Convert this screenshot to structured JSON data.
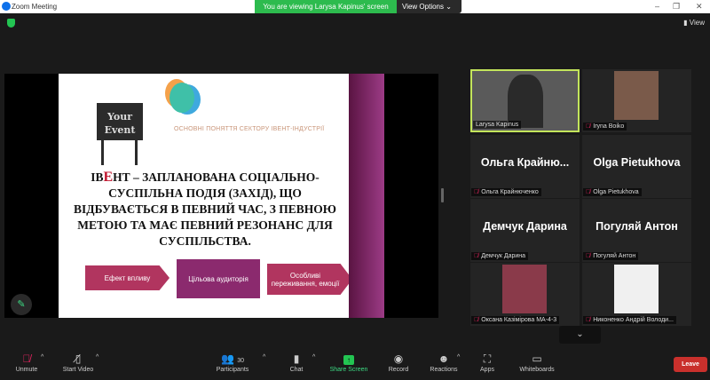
{
  "window": {
    "title": "Zoom Meeting",
    "minimize": "–",
    "maximize": "❐",
    "close": "✕"
  },
  "banner": {
    "text": "You are viewing Larysa Kapinus' screen",
    "view_options": "View Options ⌄"
  },
  "view_button": "View",
  "slide": {
    "board_text": "Your Event",
    "subtitle": "ОСНОВНІ ПОНЯТТЯ СЕКТОРУ ІВЕНТ-ІНДУСТРІЇ",
    "definition_prefix": "ІВ",
    "definition_red": "Е",
    "definition_rest": "НТ – ЗАПЛАНОВАНА СОЦІАЛЬНО-СУСПІЛЬНА ПОДІЯ (ЗАХІД), ЩО ВІДБУВАЄТЬСЯ В ПЕВНИЙ ЧАС, З ПЕВНОЮ МЕТОЮ ТА МАЄ ПЕВНИЙ РЕЗОНАНС ДЛЯ СУСПІЛЬСТВА.",
    "boxes": [
      "Ефект впливу",
      "Цільова аудиторія",
      "Особливі переживання, емоції"
    ]
  },
  "participants": [
    {
      "label": "Larysa Kapinus",
      "big": "",
      "active": true
    },
    {
      "label": "Iryna Boiko",
      "big": ""
    },
    {
      "label": "Ольга Крайнюченко",
      "big": "Ольга  Крайню..."
    },
    {
      "label": "Olga Pietukhova",
      "big": "Olga Pietukhova"
    },
    {
      "label": "Демчук Дарина",
      "big": "Демчук Дарина"
    },
    {
      "label": "Погуляй Антон",
      "big": "Погуляй Антон"
    },
    {
      "label": "Оксана Казімірова МА-4-3",
      "big": ""
    },
    {
      "label": "Никоненко Андрій Володи...",
      "big": ""
    }
  ],
  "toolbar": {
    "unmute": "Unmute",
    "start_video": "Start Video",
    "participants": "Participants",
    "participants_count": "30",
    "chat": "Chat",
    "share_screen": "Share Screen",
    "record": "Record",
    "reactions": "Reactions",
    "apps": "Apps",
    "whiteboards": "Whiteboards",
    "leave": "Leave"
  },
  "colors": {
    "accent_green": "#2dbb4e",
    "active_border": "#c3e55b",
    "leave": "#c9302c"
  }
}
